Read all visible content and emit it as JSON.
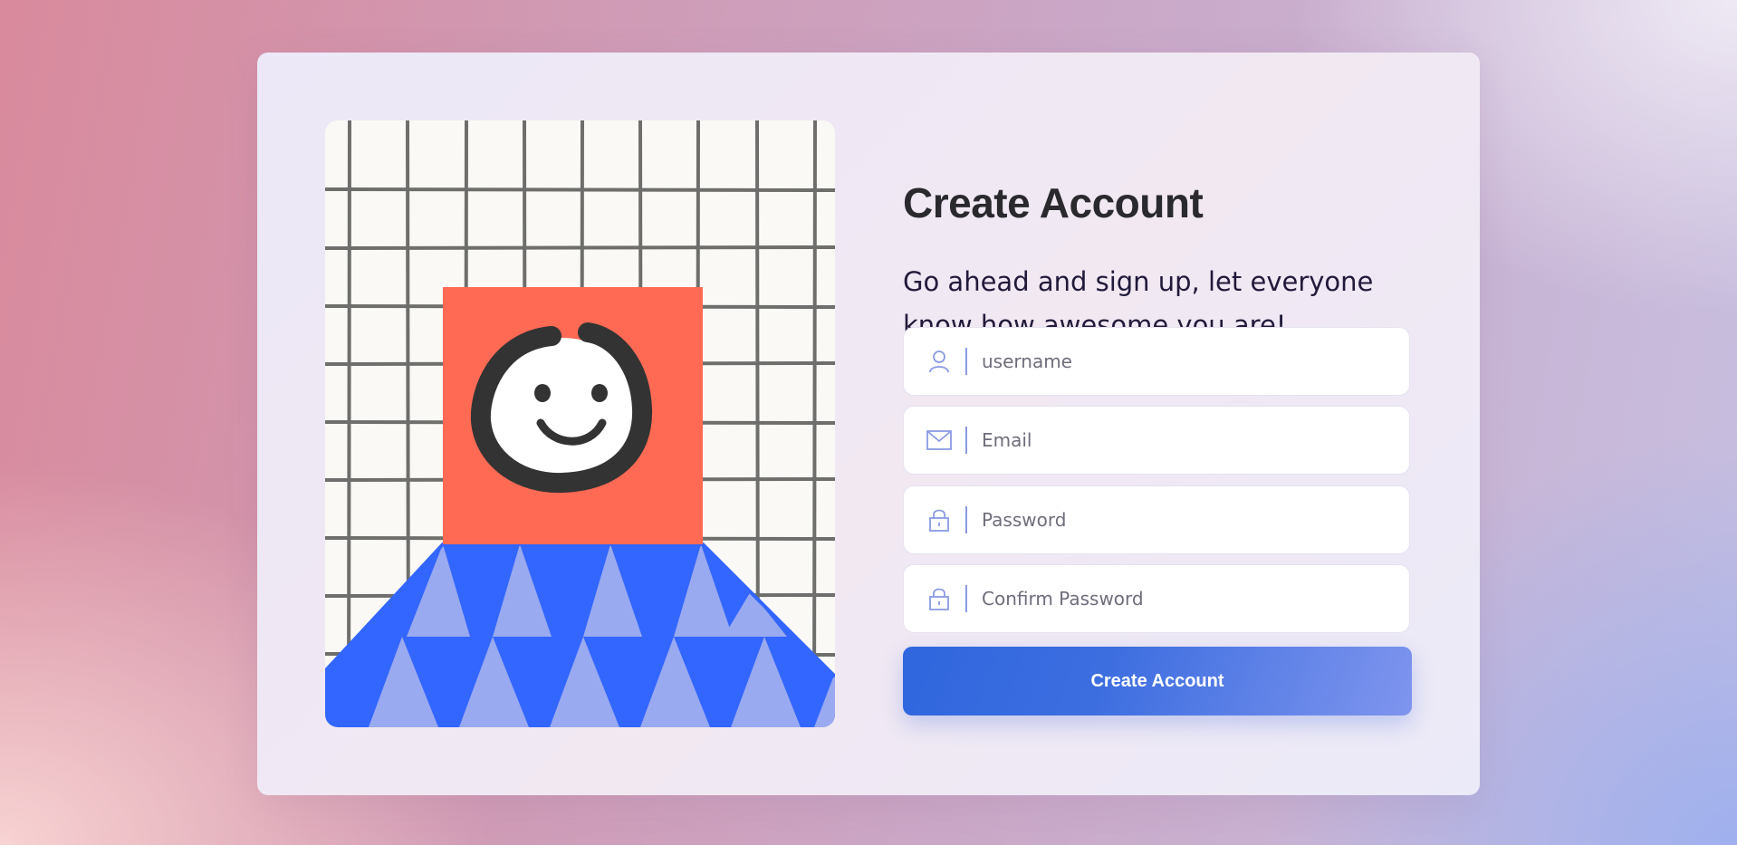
{
  "form": {
    "title": "Create Account",
    "subtitle": "Go ahead and sign up, let everyone know how awesome you are!",
    "fields": [
      {
        "icon": "user-icon",
        "placeholder": "username",
        "value": ""
      },
      {
        "icon": "mail-icon",
        "placeholder": "Email",
        "value": ""
      },
      {
        "icon": "lock-icon",
        "placeholder": "Password",
        "value": ""
      },
      {
        "icon": "lock-icon",
        "placeholder": "Confirm Password",
        "value": ""
      }
    ],
    "submit_label": "Create Account"
  },
  "colors": {
    "accent": "#3566e0",
    "icon": "#8a9ae3",
    "illustration_square": "#ff6a55",
    "illustration_blue": "#3366ff",
    "illustration_light_blue": "#9aaaf0"
  }
}
